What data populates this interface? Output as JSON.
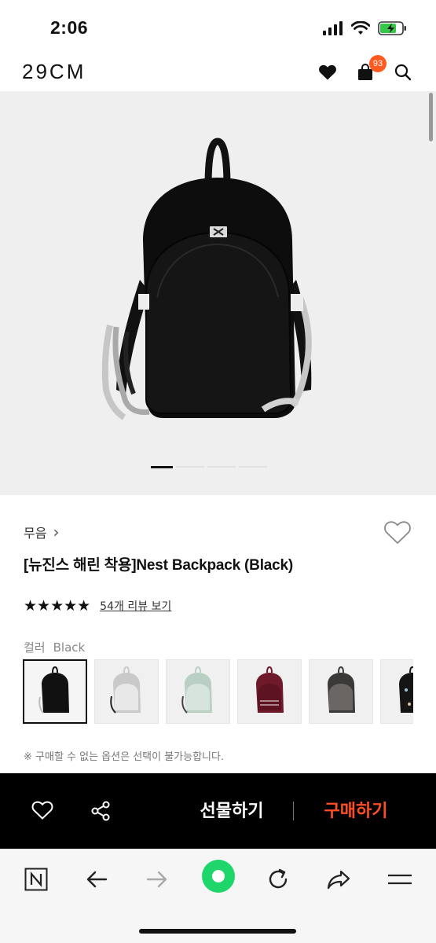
{
  "status": {
    "time": "2:06"
  },
  "header": {
    "logo": "29CM",
    "cart_count": "93"
  },
  "product": {
    "brand": "무음",
    "brand_chevron": "›",
    "title": "[뉴진스 해린 착용]Nest Backpack (Black)",
    "rating_stars": "★★★★★",
    "rating": 5,
    "review_link": "54개 리뷰 보기"
  },
  "options": {
    "color_label": "컬러",
    "color_value": "Black",
    "swatches": [
      {
        "name": "Black",
        "color": "#111111"
      },
      {
        "name": "Gray",
        "color": "#c9c9c9"
      },
      {
        "name": "Mint",
        "color": "#b9cfc4"
      },
      {
        "name": "Burgundy",
        "color": "#6e1a2a"
      },
      {
        "name": "Charcoal",
        "color": "#5a5654"
      },
      {
        "name": "Black Pattern",
        "color": "#151515"
      }
    ],
    "notice": "※ 구매할 수 없는 옵션은 선택이 불가능합니다."
  },
  "action_bar": {
    "gift_label": "선물하기",
    "buy_label": "구매하기"
  },
  "colors": {
    "accent": "#ff4d24",
    "badge": "#ff5a1f",
    "action_bar_bg": "#000000",
    "nav_green": "#1fd66a"
  },
  "icons": {
    "header": [
      "heart-icon",
      "shopping-bag-icon",
      "search-icon"
    ],
    "browser": [
      "naver-n-icon",
      "back-arrow-icon",
      "forward-arrow-icon",
      "green-home-icon",
      "refresh-icon",
      "share-arrow-icon",
      "menu-icon"
    ]
  }
}
